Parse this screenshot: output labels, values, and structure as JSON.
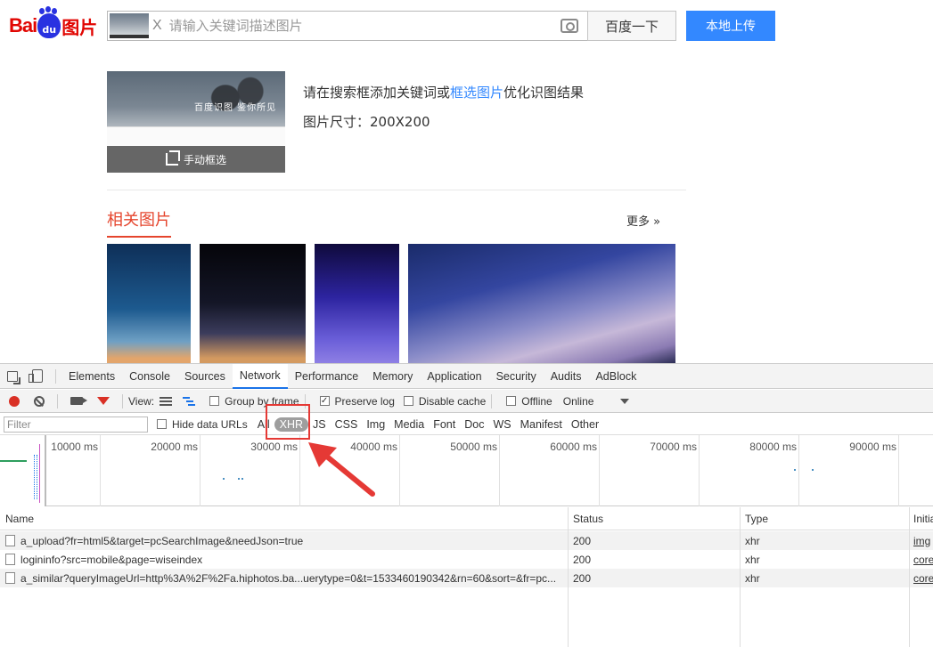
{
  "logo": {
    "text_bai": "Bai",
    "text_du": "du",
    "text_tupian": "图片"
  },
  "search": {
    "clear_label": "X",
    "placeholder": "请输入关键词描述图片",
    "submit_label": "百度一下",
    "upload_label": "本地上传"
  },
  "query": {
    "hero_text": "百度识图  鉴你所见",
    "crop_label": "手动框选",
    "hint_before": "请在搜索框添加关键词或",
    "hint_link": "框选图片",
    "hint_after": "优化识图结果",
    "size_label": "图片尺寸：200X200"
  },
  "related": {
    "title": "相关图片",
    "more_label": "更多 »"
  },
  "devtools": {
    "tabs": [
      "Elements",
      "Console",
      "Sources",
      "Network",
      "Performance",
      "Memory",
      "Application",
      "Security",
      "Audits",
      "AdBlock"
    ],
    "active_tab": "Network",
    "toolbar": {
      "view_label": "View:",
      "group_by_frame": "Group by frame",
      "preserve_log": "Preserve log",
      "disable_cache": "Disable cache",
      "offline": "Offline",
      "throttle": "Online"
    },
    "filter": {
      "placeholder": "Filter",
      "hide_data_urls": "Hide data URLs",
      "types": [
        "All",
        "XHR",
        "JS",
        "CSS",
        "Img",
        "Media",
        "Font",
        "Doc",
        "WS",
        "Manifest",
        "Other"
      ],
      "selected_type": "XHR"
    },
    "overview_ticks": [
      "10000 ms",
      "20000 ms",
      "30000 ms",
      "40000 ms",
      "50000 ms",
      "60000 ms",
      "70000 ms",
      "80000 ms",
      "90000 ms"
    ],
    "columns": {
      "name": "Name",
      "status": "Status",
      "type": "Type",
      "initiator": "Initia"
    },
    "rows": [
      {
        "name": "a_upload?fr=html5&target=pcSearchImage&needJson=true",
        "status": "200",
        "type": "xhr",
        "initiator": "img"
      },
      {
        "name": "logininfo?src=mobile&page=wiseindex",
        "status": "200",
        "type": "xhr",
        "initiator": "core"
      },
      {
        "name": "a_similar?queryImageUrl=http%3A%2F%2Fa.hiphotos.ba...uerytype=0&t=1533460190342&rn=60&sort=&fr=pc...",
        "status": "200",
        "type": "xhr",
        "initiator": "core"
      }
    ]
  },
  "colors": {
    "accent_blue": "#3388ff",
    "logo_red": "#e10602",
    "highlight_red": "#e53935"
  }
}
